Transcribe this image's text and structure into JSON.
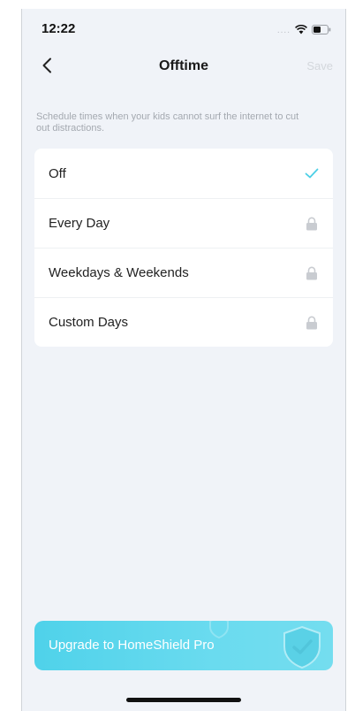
{
  "status_bar": {
    "time": "12:22",
    "signal": "....",
    "icons": [
      "wifi-icon",
      "battery-icon"
    ]
  },
  "nav": {
    "title": "Offtime",
    "save_label": "Save",
    "back_icon": "chevron-left-icon"
  },
  "description": "Schedule times when your kids cannot surf the internet to cut out distractions.",
  "options": [
    {
      "label": "Off",
      "state": "selected",
      "icon": "check-icon"
    },
    {
      "label": "Every Day",
      "state": "locked",
      "icon": "lock-icon"
    },
    {
      "label": "Weekdays & Weekends",
      "state": "locked",
      "icon": "lock-icon"
    },
    {
      "label": "Custom Days",
      "state": "locked",
      "icon": "lock-icon"
    }
  ],
  "upgrade": {
    "label": "Upgrade to HomeShield Pro",
    "icon": "shield-check-icon"
  },
  "colors": {
    "accent": "#4fd2ea",
    "check": "#4ccfe6",
    "lock": "#c9ccd1",
    "background": "#f0f3f8"
  }
}
